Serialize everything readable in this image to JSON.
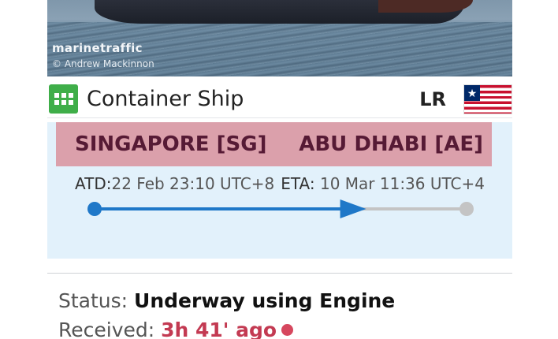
{
  "photo": {
    "watermark": "marinetraffic",
    "credit": "© Andrew Mackinnon"
  },
  "vessel": {
    "type_label": "Container Ship",
    "type_icon": "container-grid-icon",
    "flag_code": "LR",
    "flag_icon": "liberia-flag-icon"
  },
  "route": {
    "origin": "SINGAPORE [SG]",
    "destination": "ABU DHABI [AE]",
    "atd_label": "ATD:",
    "atd_value": "22 Feb 23:10 UTC+8",
    "eta_label": "ETA:",
    "eta_value": "10 Mar 11:36 UTC+4",
    "progress": 0.73
  },
  "status": {
    "label": "Status:",
    "value": "Underway using Engine"
  },
  "received": {
    "label": "Received:",
    "value": "3h 41' ago"
  },
  "colors": {
    "route_bg": "#e2f1fb",
    "ports_bg": "#dba0ab",
    "port_text": "#561a35",
    "progress_line": "#1f78c8",
    "remaining_line": "#c4c4c4",
    "received_text": "#c33a52",
    "type_icon_bg": "#3fae49"
  }
}
